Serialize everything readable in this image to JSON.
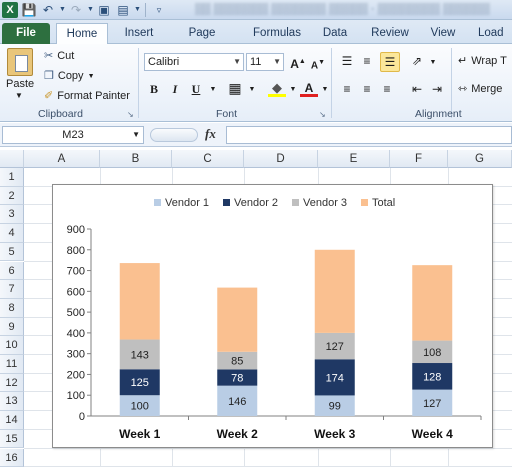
{
  "qat": {
    "app_icon": "X"
  },
  "tabs": [
    "File",
    "Home",
    "Insert",
    "Page Layout",
    "Formulas",
    "Data",
    "Review",
    "View",
    "Load T"
  ],
  "clipboard": {
    "paste": "Paste",
    "cut": "Cut",
    "copy": "Copy",
    "format_painter": "Format Painter",
    "label": "Clipboard"
  },
  "font": {
    "name": "Calibri",
    "size": "11",
    "bold": "B",
    "italic": "I",
    "underline": "U",
    "label": "Font"
  },
  "alignment": {
    "wrap": "Wrap T",
    "merge": "Merge",
    "label": "Alignment"
  },
  "formula_bar": {
    "name_box": "M23",
    "fx": "fx"
  },
  "columns": [
    "A",
    "B",
    "C",
    "D",
    "E",
    "F",
    "G"
  ],
  "rows": [
    "1",
    "2",
    "3",
    "4",
    "5",
    "6",
    "7",
    "8",
    "9",
    "10",
    "11",
    "12",
    "13",
    "14",
    "15",
    "16"
  ],
  "colors": {
    "vendor1": "#b9cde5",
    "vendor2": "#1f3864",
    "vendor3": "#bfbfbf",
    "total": "#fac090"
  },
  "chart_data": {
    "type": "bar",
    "stacked": true,
    "categories": [
      "Week 1",
      "Week 2",
      "Week 3",
      "Week 4"
    ],
    "series": [
      {
        "name": "Vendor 1",
        "values": [
          100,
          146,
          99,
          127
        ]
      },
      {
        "name": "Vendor 2",
        "values": [
          125,
          78,
          174,
          128
        ]
      },
      {
        "name": "Vendor 3",
        "values": [
          143,
          85,
          127,
          108
        ]
      },
      {
        "name": "Total",
        "values": [
          368,
          309,
          400,
          363
        ]
      }
    ],
    "ylim": [
      0,
      900
    ],
    "yticks": [
      "0",
      "100",
      "200",
      "300",
      "400",
      "500",
      "600",
      "700",
      "800",
      "900"
    ],
    "legend": "top",
    "grid": false
  }
}
